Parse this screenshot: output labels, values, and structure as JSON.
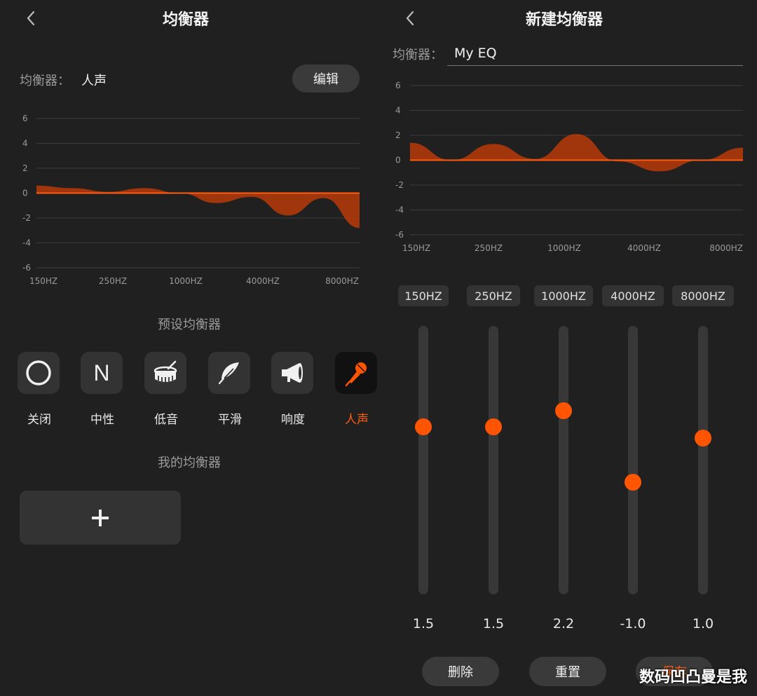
{
  "left": {
    "title": "均衡器",
    "eq_label": "均衡器：",
    "eq_value": "人声",
    "edit_label": "编辑",
    "preset_section_title": "预设均衡器",
    "my_section_title": "我的均衡器",
    "presets": [
      {
        "label": "关闭",
        "icon": "circle-icon"
      },
      {
        "label": "中性",
        "icon": "letter-n-icon",
        "glyph": "N"
      },
      {
        "label": "低音",
        "icon": "drum-icon"
      },
      {
        "label": "平滑",
        "icon": "feather-icon"
      },
      {
        "label": "响度",
        "icon": "megaphone-icon"
      },
      {
        "label": "人声",
        "icon": "microphone-icon",
        "active": true
      }
    ],
    "add_icon": "plus-icon"
  },
  "right": {
    "title": "新建均衡器",
    "eq_label": "均衡器：",
    "eq_name_value": "My EQ",
    "bands": [
      {
        "label": "150HZ",
        "value": "1.5"
      },
      {
        "label": "250HZ",
        "value": "1.5"
      },
      {
        "label": "1000HZ",
        "value": "2.2"
      },
      {
        "label": "4000HZ",
        "value": "-1.0"
      },
      {
        "label": "8000HZ",
        "value": "1.0"
      }
    ],
    "slider_range": [
      -6,
      6
    ],
    "buttons": {
      "delete": "删除",
      "reset": "重置",
      "save": "保存"
    }
  },
  "watermark": "数码凹凸曼是我",
  "colors": {
    "accent": "#ff5500",
    "background": "#202020",
    "card": "#333333",
    "muted_text": "#9a9a9a"
  },
  "chart_data": [
    {
      "type": "area",
      "x_ticks": [
        "150HZ",
        "250HZ",
        "1000HZ",
        "4000HZ",
        "8000HZ"
      ],
      "y_ticks": [
        "6",
        "4",
        "2",
        "0",
        "-2",
        "-4",
        "-6"
      ],
      "ylim": [
        -6,
        6
      ],
      "grid": true,
      "series": [
        {
          "values": [
            0.6,
            0.4,
            0.1,
            0.4,
            0.0,
            -0.8,
            -0.3,
            -1.8,
            -0.4,
            -2.8
          ]
        }
      ]
    },
    {
      "type": "area",
      "x_ticks": [
        "150HZ",
        "250HZ",
        "1000HZ",
        "4000HZ",
        "8000HZ"
      ],
      "y_ticks": [
        "6",
        "4",
        "2",
        "0",
        "-2",
        "-4",
        "-6"
      ],
      "ylim": [
        -6,
        6
      ],
      "grid": true,
      "series": [
        {
          "values": [
            1.4,
            0.0,
            1.3,
            0.1,
            2.1,
            -0.1,
            -0.9,
            0.0,
            1.0
          ]
        }
      ]
    }
  ]
}
